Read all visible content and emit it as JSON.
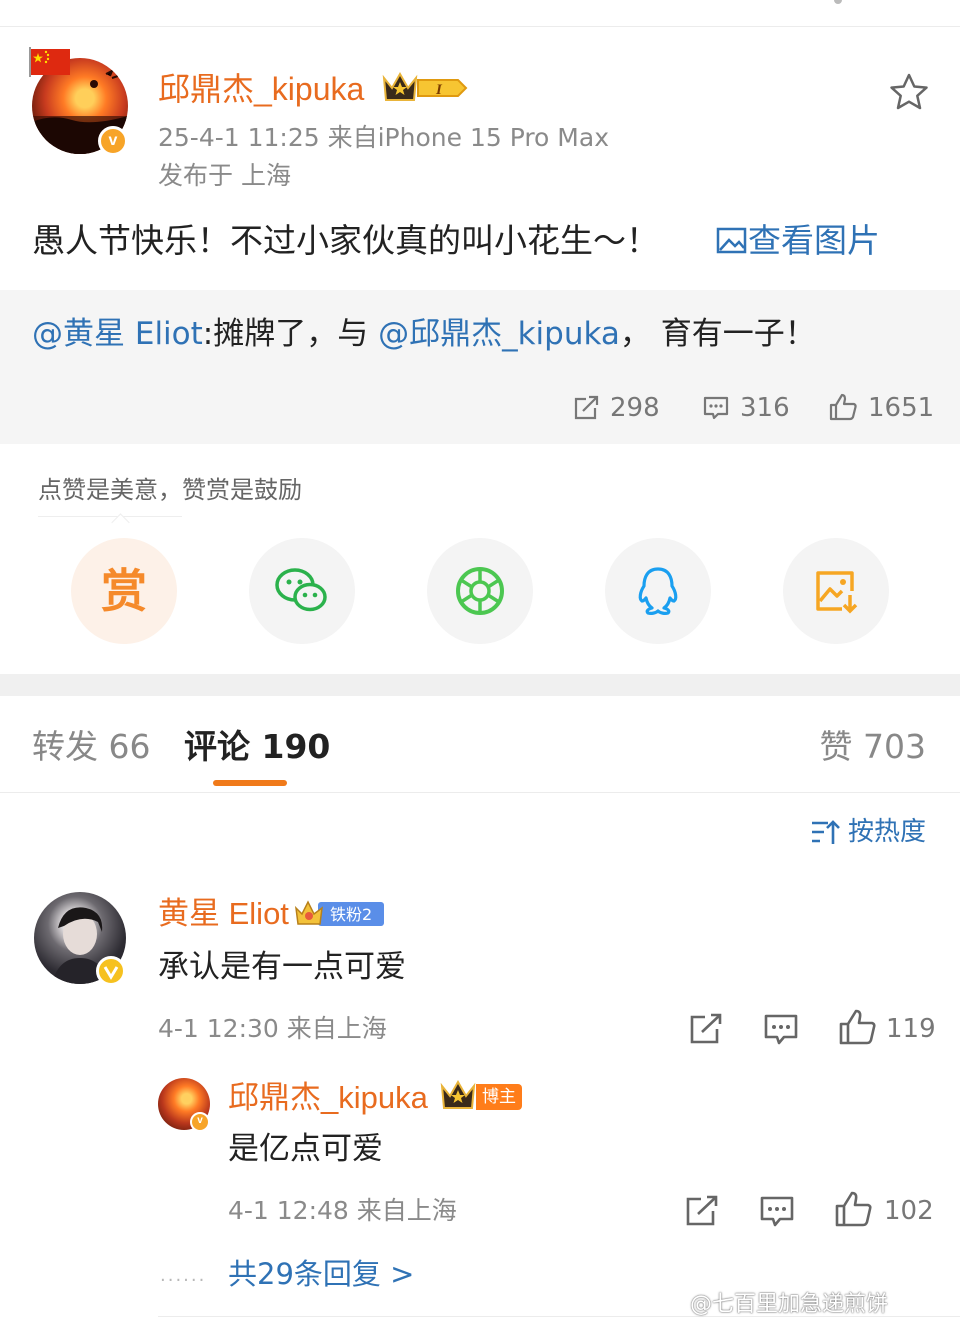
{
  "post": {
    "author": "邱鼎杰_kipuka",
    "level_badge": "I",
    "verified_mark": "v",
    "meta_line": "25-4-1 11:25  来自iPhone 15 Pro Max",
    "location": "发布于 上海",
    "text": "愚人节快乐！不过小家伙真的叫小花生～！",
    "image_link": "查看图片",
    "icons": [
      "china-flag-icon",
      "crown-icon",
      "star-icon",
      "image-icon"
    ]
  },
  "repost": {
    "mention1": "@黄星 Eliot",
    "text1": ":摊牌了，与 ",
    "mention2": "@邱鼎杰_kipuka",
    "text2": "， 育有一子！",
    "shares": "298",
    "comments": "316",
    "likes": "1651"
  },
  "reward": {
    "hint": "点赞是美意，赞赏是鼓励",
    "reward_char": "赏",
    "share_targets": [
      "reward",
      "wechat",
      "moments",
      "qq",
      "save-image"
    ],
    "colors": {
      "reward": "#f58a2b",
      "wechat": "#2bb24c",
      "moments": "#4cc751",
      "qq": "#1a9ff0",
      "save": "#f6a623"
    }
  },
  "tabs": {
    "repost_label": "转发 66",
    "comment_label": "评论 190",
    "like_label": "赞 703",
    "sort_label": "按热度"
  },
  "comments": [
    {
      "name": "黄星 Eliot",
      "badge": "铁粉2",
      "text": "承认是有一点可爱",
      "meta": "4-1 12:30  来自上海",
      "likes": "119"
    }
  ],
  "reply": {
    "name": "邱鼎杰_kipuka",
    "badge": "博主",
    "text": "是亿点可爱",
    "meta": "4-1 12:48  来自上海",
    "likes": "102",
    "more_dots": "······",
    "more_replies": "共29条回复 >"
  },
  "watermark": "@七百里加急递煎饼",
  "accent": "#f07a1a",
  "link_color": "#2f72b5"
}
